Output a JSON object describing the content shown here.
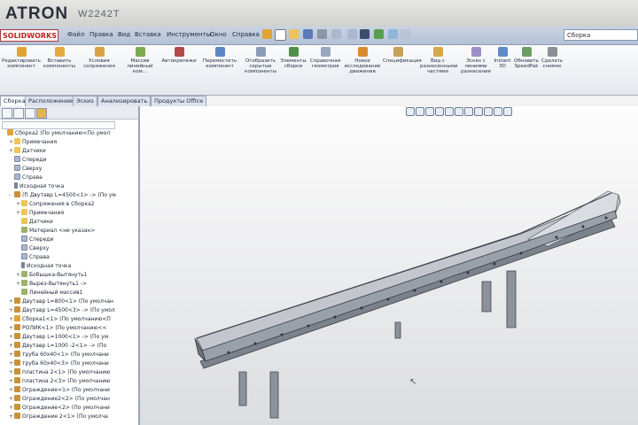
{
  "monitor": {
    "brand": "ATRON",
    "model": "W2242T"
  },
  "app": {
    "logo_text": "SOLIDWORKS",
    "menu": [
      "Файл",
      "Правка",
      "Вид",
      "Вставка",
      "Инструменты",
      "Окно",
      "Справка"
    ],
    "search_text": "Сборка"
  },
  "ribbon": {
    "buttons": [
      "Редактировать компонент",
      "Вставить компоненты",
      "Условия сопряжения",
      "Массив линейный ком...",
      "Автокрепежи",
      "Переместить компонент",
      "Отобразить скрытые компоненты",
      "Элементы сборки",
      "Справочная геометрия",
      "Новое исследование движения",
      "Спецификация",
      "Вид с разнесенными частями",
      "Эскиз с линиями разнесения",
      "Instant 3D",
      "Обновить SpeedPak",
      "Сделать снимок"
    ]
  },
  "tabs": [
    "Сборка",
    "Расположение",
    "Эскиз",
    "Анализировать",
    "Продукты Office"
  ],
  "tree": [
    {
      "label": "Сборка2  (По умолчанию<По умол",
      "icon": "asm",
      "level": 0,
      "exp": ""
    },
    {
      "label": "Примечания",
      "icon": "fold",
      "level": 1,
      "exp": "+"
    },
    {
      "label": "Датчики",
      "icon": "fold",
      "level": 1,
      "exp": "+"
    },
    {
      "label": "Спереди",
      "icon": "plane",
      "level": 1,
      "exp": ""
    },
    {
      "label": "Сверху",
      "icon": "plane",
      "level": 1,
      "exp": ""
    },
    {
      "label": "Справа",
      "icon": "plane",
      "level": 1,
      "exp": ""
    },
    {
      "label": "Исходная точка",
      "icon": "origin",
      "level": 1,
      "exp": ""
    },
    {
      "label": "(f) Двутавр L=4500<1> -> (По ум",
      "icon": "part",
      "level": 1,
      "exp": "-"
    },
    {
      "label": "Сопряжения в Сборка2",
      "icon": "fold",
      "level": 2,
      "exp": "+"
    },
    {
      "label": "Примечания",
      "icon": "fold",
      "level": 2,
      "exp": "+"
    },
    {
      "label": "Датчики",
      "icon": "fold",
      "level": 2,
      "exp": ""
    },
    {
      "label": "Материал <не указан>",
      "icon": "feat",
      "level": 2,
      "exp": ""
    },
    {
      "label": "Спереди",
      "icon": "plane",
      "level": 2,
      "exp": ""
    },
    {
      "label": "Сверху",
      "icon": "plane",
      "level": 2,
      "exp": ""
    },
    {
      "label": "Справа",
      "icon": "plane",
      "level": 2,
      "exp": ""
    },
    {
      "label": "Исходная точка",
      "icon": "origin",
      "level": 2,
      "exp": ""
    },
    {
      "label": "Бобышка-Вытянуть1",
      "icon": "feat",
      "level": 2,
      "exp": "+"
    },
    {
      "label": "Вырез-Вытянуть1 ->",
      "icon": "feat",
      "level": 2,
      "exp": "+"
    },
    {
      "label": "Линейный массив1",
      "icon": "feat",
      "level": 2,
      "exp": ""
    },
    {
      "label": "Двутавр L=800<1> (По умолчан",
      "icon": "part",
      "level": 1,
      "exp": "+"
    },
    {
      "label": "Двутавр L=4500<3> -> (По умол",
      "icon": "part",
      "level": 1,
      "exp": "+"
    },
    {
      "label": "Сборка1<1> (По умолчанию<П",
      "icon": "asm",
      "level": 1,
      "exp": "+"
    },
    {
      "label": "РОЛИК<1> (По умолчанию<<",
      "icon": "part",
      "level": 1,
      "exp": "+"
    },
    {
      "label": "Двутавр L=1000<1> -> (По ум",
      "icon": "part",
      "level": 1,
      "exp": "+"
    },
    {
      "label": "Двутавр L=1000 -2<1> -> (По",
      "icon": "part",
      "level": 1,
      "exp": "+"
    },
    {
      "label": "труба 60x40<1> (По умолчани",
      "icon": "part",
      "level": 1,
      "exp": "+"
    },
    {
      "label": "труба 60x40<3> (По умолчани",
      "icon": "part",
      "level": 1,
      "exp": "+"
    },
    {
      "label": "пластина 2<1> (По умолчанию",
      "icon": "part",
      "level": 1,
      "exp": "+"
    },
    {
      "label": "пластина 2<3> (По умолчанию",
      "icon": "part",
      "level": 1,
      "exp": "+"
    },
    {
      "label": "Ограждение<1> (По умолчани",
      "icon": "part",
      "level": 1,
      "exp": "+"
    },
    {
      "label": "Ограждение2<2> (По умолчан",
      "icon": "part",
      "level": 1,
      "exp": "+"
    },
    {
      "label": "Ограждение<2> (По умолчани",
      "icon": "part",
      "level": 1,
      "exp": "+"
    },
    {
      "label": "Ограждение 2<1> (По умолча",
      "icon": "part",
      "level": 1,
      "exp": "+"
    }
  ]
}
